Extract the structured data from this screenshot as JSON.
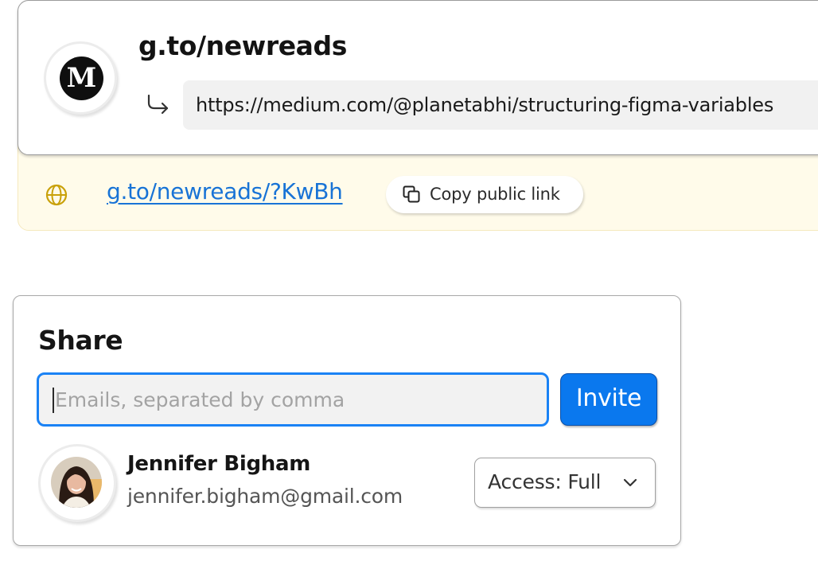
{
  "link": {
    "short_url": "g.to/newreads",
    "destination_url": "https://medium.com/@planetabhi/structuring-figma-variables",
    "logo_letter": "M",
    "public_link": "g.to/newreads/?KwBh",
    "copy_label": "Copy public link"
  },
  "share": {
    "title": "Share",
    "input_placeholder": "Emails, separated by comma",
    "input_value": "",
    "invite_label": "Invite",
    "user": {
      "name": "Jennifer Bigham",
      "email": "jennifer.bigham@gmail.com",
      "access_label": "Access: Full"
    }
  },
  "colors": {
    "accent": "#0a78ee",
    "link": "#1873d6",
    "public_bar_bg": "#fffbea",
    "globe": "#c9a10a"
  },
  "icons": [
    "medium-logo-icon",
    "redirect-arrow-icon",
    "globe-icon",
    "copy-icon",
    "chevron-down-icon"
  ]
}
